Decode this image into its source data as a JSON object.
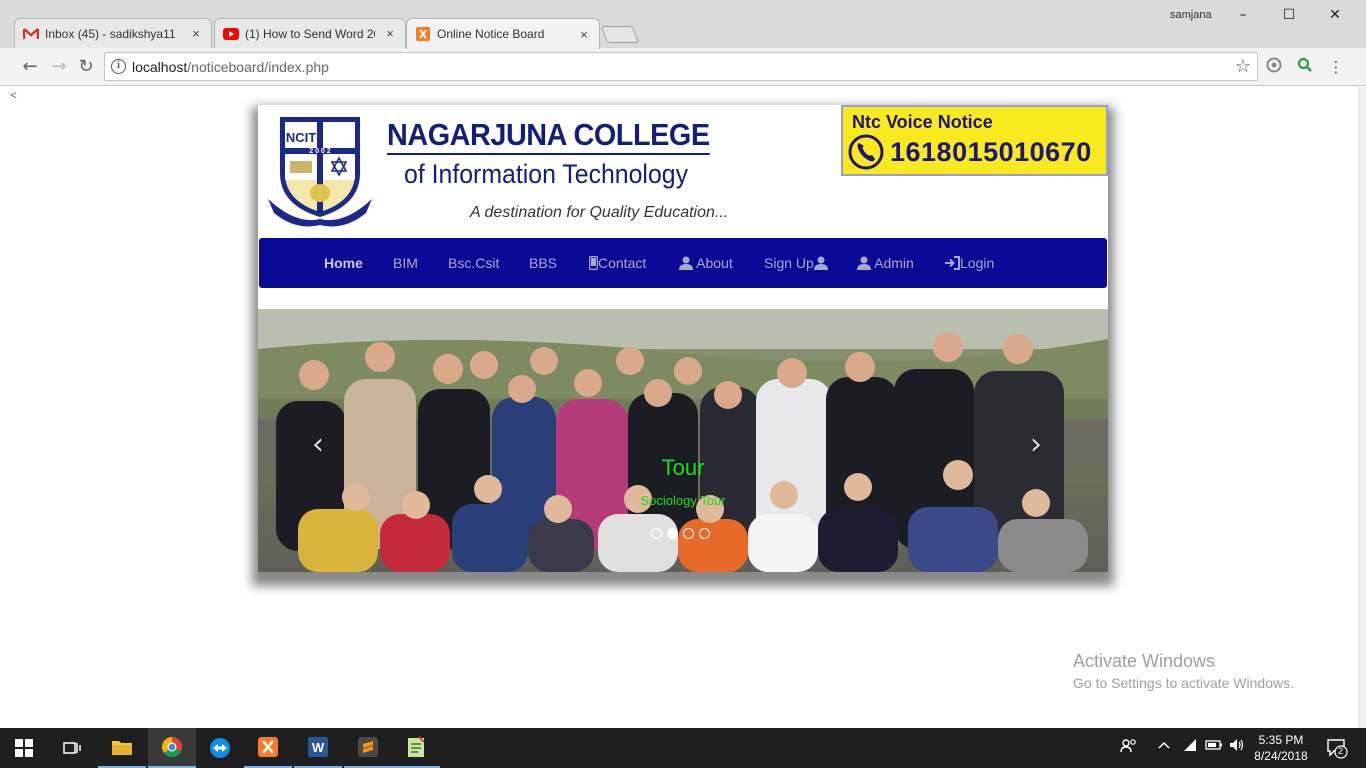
{
  "browser": {
    "tabs": [
      {
        "title": "Inbox (45) - sadikshya11",
        "icon": "gmail-icon",
        "close": "×"
      },
      {
        "title": "(1) How to Send Word 20",
        "icon": "youtube-icon",
        "close": "×"
      },
      {
        "title": "Online Notice Board",
        "icon": "xampp-icon",
        "close": "×",
        "active": true
      }
    ],
    "profile_name": "samjana",
    "window_controls": {
      "minimize": "–",
      "maximize": "☐",
      "close": "✕"
    },
    "nav": {
      "back": "←",
      "forward": "→",
      "reload": "↻"
    },
    "address": {
      "host": "localhost",
      "path": "/noticeboard/index.php"
    },
    "bookmark_star": "☆",
    "menu": "⋮"
  },
  "page": {
    "stray_text": "<",
    "college": {
      "name": "NAGARJUNA COLLEGE",
      "subtitle": "of Information Technology",
      "tagline": "A destination for Quality Education...",
      "logo_text": "NCIT",
      "logo_year": "2002"
    },
    "voice_notice": {
      "title": "Ntc Voice Notice",
      "number": "1618015010670",
      "icon": "phone-icon"
    },
    "navbar": {
      "items": [
        {
          "label": "Home",
          "active": true
        },
        {
          "label": "BIM"
        },
        {
          "label": "Bsc.Csit"
        },
        {
          "label": "BBS"
        },
        {
          "label": "Contact",
          "icon": "mobile-icon"
        },
        {
          "label": "About",
          "icon": "user-icon"
        },
        {
          "label": "Sign Up",
          "icon": "user-icon"
        },
        {
          "label": "Admin",
          "icon": "user-icon"
        },
        {
          "label": "Login",
          "icon": "login-icon"
        }
      ]
    },
    "carousel": {
      "caption_title": "Tour",
      "caption_text": "Sociology Tour",
      "prev": "‹",
      "next": "›",
      "slide_count": 4,
      "active_slide": 2
    },
    "watermark": {
      "line1": "Activate Windows",
      "line2": "Go to Settings to activate Windows."
    }
  },
  "taskbar": {
    "apps": [
      "start-icon",
      "task-view-icon",
      "file-explorer-icon",
      "chrome-icon",
      "teamviewer-icon",
      "xampp-icon",
      "word-icon",
      "sublime-icon",
      "notepad-icon"
    ],
    "time": "5:35 PM",
    "date": "8/24/2018",
    "notifications": "2"
  },
  "colors": {
    "navbar_bg": "#0a0a96",
    "college_text": "#111e7a",
    "voice_bg": "#f8ea1c",
    "caption": "#18e018"
  }
}
